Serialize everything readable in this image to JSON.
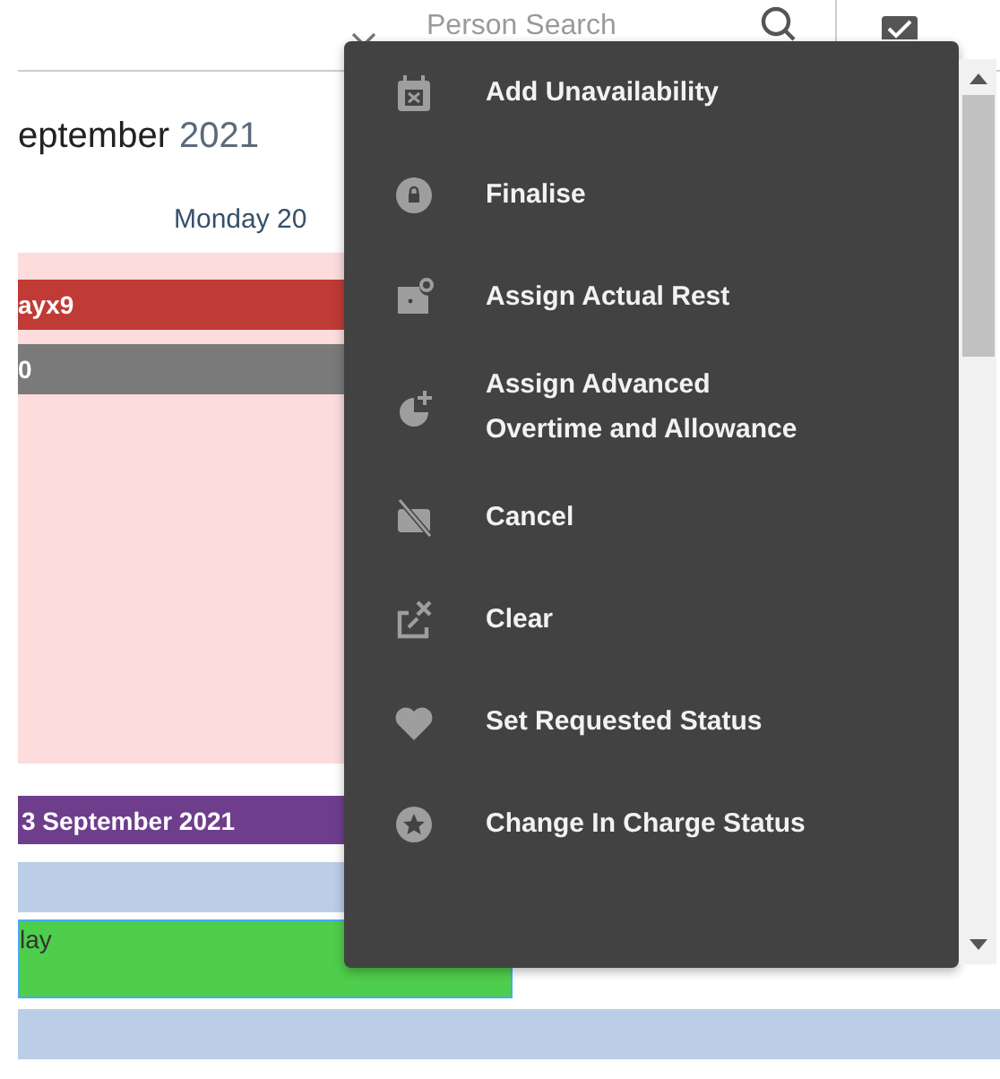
{
  "header": {
    "search": {
      "placeholder": "Person Search"
    }
  },
  "calendar": {
    "title": {
      "month": "eptember",
      "year": "2021"
    },
    "day_heading": "Monday 20",
    "events": [
      {
        "label": "ayx9",
        "color": "#c03a36"
      },
      {
        "label": "0",
        "color": "#7a7a7a"
      }
    ],
    "week_banner": {
      "label": "3 September 2021",
      "color": "#6e3e8c"
    },
    "shifts": [
      {
        "kind": "empty",
        "selected": false
      },
      {
        "label": "lay",
        "kind": "shift",
        "selected": true
      }
    ]
  },
  "context_menu": {
    "items": [
      {
        "label": "Add Unavailability"
      },
      {
        "label": "Finalise"
      },
      {
        "label": "Assign Actual Rest"
      },
      {
        "label": "Assign Advanced Overtime and Allowance"
      },
      {
        "label": "Cancel"
      },
      {
        "label": "Clear"
      },
      {
        "label": "Set Requested Status"
      },
      {
        "label": "Change In Charge Status"
      }
    ]
  }
}
